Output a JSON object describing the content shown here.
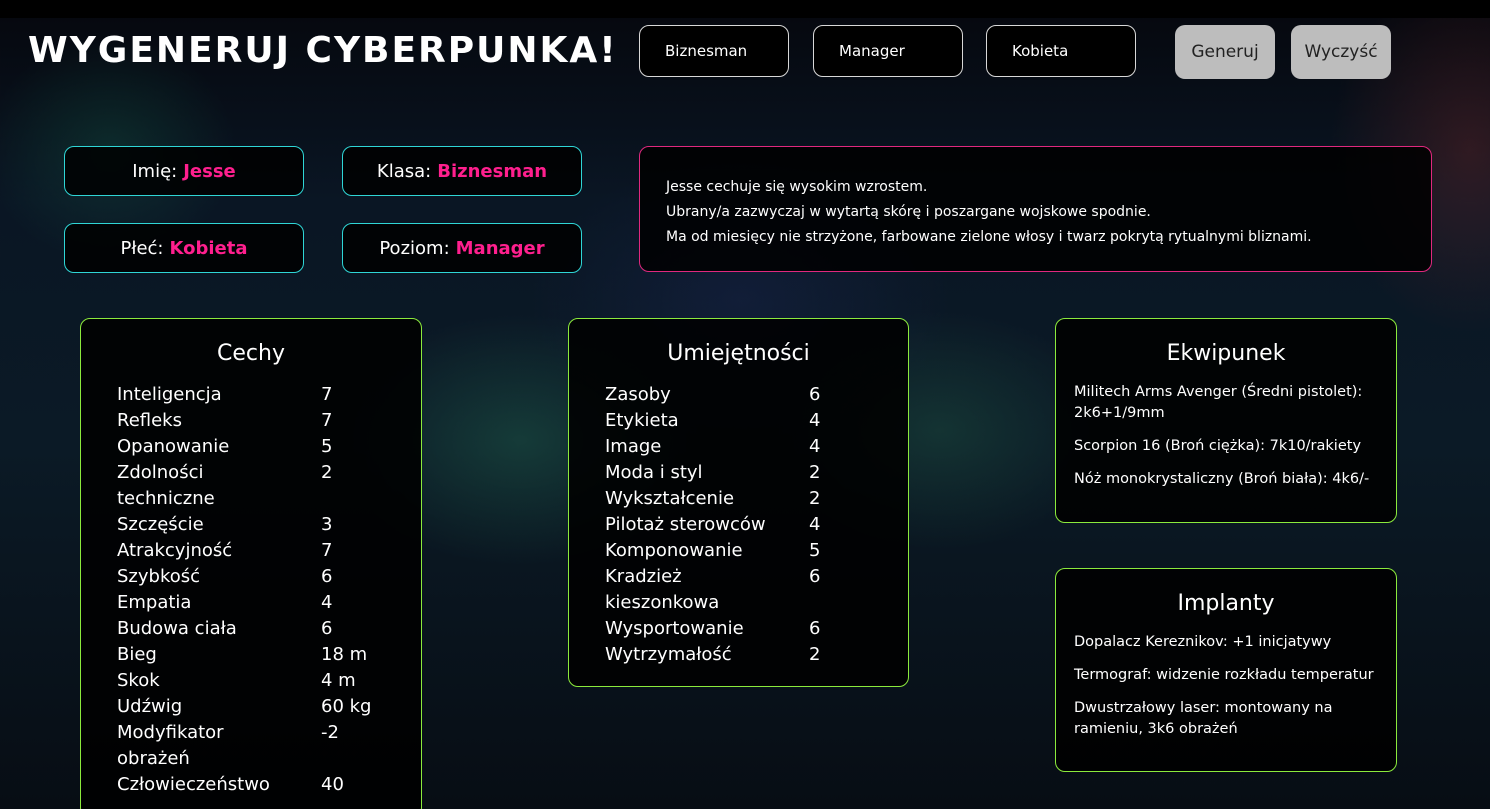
{
  "header": {
    "title": "WYGENERUJ CYBERPUNKA!",
    "select_class": "Biznesman",
    "select_level": "Manager",
    "select_gender": "Kobieta",
    "generate_label": "Generuj",
    "clear_label": "Wyczyść"
  },
  "character": {
    "name_label": "Imię:",
    "name": "Jesse",
    "class_label": "Klasa:",
    "class": "Biznesman",
    "gender_label": "Płeć:",
    "gender": "Kobieta",
    "level_label": "Poziom:",
    "level": "Manager"
  },
  "description": [
    "Jesse cechuje się wysokim wzrostem.",
    "Ubrany/a zazwyczaj w wytartą skórę i poszargane wojskowe spodnie.",
    "Ma od miesięcy nie strzyżone, farbowane zielone włosy i twarz pokrytą rytualnymi bliznami."
  ],
  "traits": {
    "title": "Cechy",
    "items": [
      {
        "name": "Inteligencja",
        "value": "7"
      },
      {
        "name": "Refleks",
        "value": "7"
      },
      {
        "name": "Opanowanie",
        "value": "5"
      },
      {
        "name": "Zdolności techniczne",
        "value": "2"
      },
      {
        "name": "Szczęście",
        "value": "3"
      },
      {
        "name": "Atrakcyjność",
        "value": "7"
      },
      {
        "name": "Szybkość",
        "value": "6"
      },
      {
        "name": "Empatia",
        "value": "4"
      },
      {
        "name": "Budowa ciała",
        "value": "6"
      },
      {
        "name": "Bieg",
        "value": "18 m"
      },
      {
        "name": "Skok",
        "value": "4 m"
      },
      {
        "name": "Udźwig",
        "value": "60 kg"
      },
      {
        "name": "Modyfikator obrażeń",
        "value": "-2"
      },
      {
        "name": "Człowieczeństwo",
        "value": "40"
      }
    ]
  },
  "skills": {
    "title": "Umiejętności",
    "items": [
      {
        "name": "Zasoby",
        "value": "6"
      },
      {
        "name": "Etykieta",
        "value": "4"
      },
      {
        "name": "Image",
        "value": "4"
      },
      {
        "name": "Moda i styl",
        "value": "2"
      },
      {
        "name": "Wykształcenie",
        "value": "2"
      },
      {
        "name": "Pilotaż sterowców",
        "value": "4"
      },
      {
        "name": "Komponowanie",
        "value": "5"
      },
      {
        "name": "Kradzież kieszonkowa",
        "value": "6"
      },
      {
        "name": "Wysportowanie",
        "value": "6"
      },
      {
        "name": "Wytrzymałość",
        "value": "2"
      }
    ]
  },
  "equipment": {
    "title": "Ekwipunek",
    "items": [
      "Militech Arms Avenger (Średni pistolet): 2k6+1/9mm",
      "Scorpion 16 (Broń ciężka): 7k10/rakiety",
      "Nóż monokrystaliczny (Broń biała): 4k6/-"
    ]
  },
  "implants": {
    "title": "Implanty",
    "items": [
      "Dopalacz Kereznikov: +1 inicjatywy",
      "Termograf: widzenie rozkładu temperatur",
      "Dwustrzałowy laser: montowany na ramieniu, 3k6 obrażeń"
    ]
  },
  "colors": {
    "accent_pink": "#ff1f8e",
    "cyan_border": "#2fd6d6",
    "green_border": "#8bea3c",
    "pink_border": "#e0287e"
  }
}
